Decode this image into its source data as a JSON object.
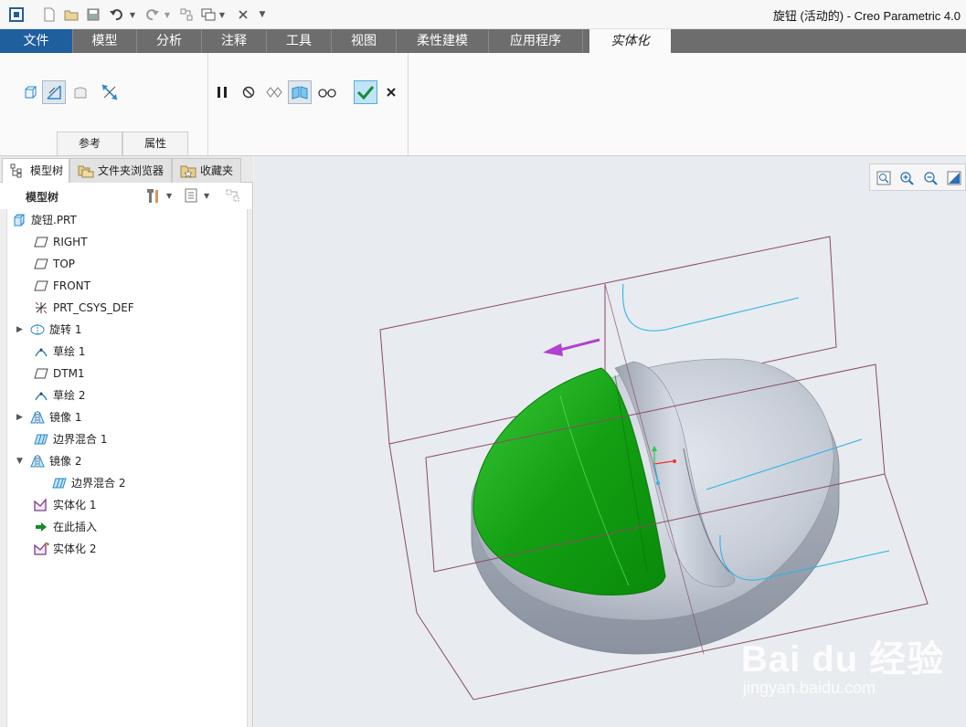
{
  "window": {
    "title": "旋钮 (活动的) - Creo Parametric 4.0"
  },
  "colors": {
    "accent": "#1f5f9e",
    "tabbar": "#6d6d6d",
    "solid_green": "#1aaa1a",
    "body_gray": "#aab2bf",
    "plane_line": "#8a4a66",
    "curve": "#2bb5e8"
  },
  "tabs": [
    {
      "label": "文件"
    },
    {
      "label": "模型"
    },
    {
      "label": "分析"
    },
    {
      "label": "注释"
    },
    {
      "label": "工具"
    },
    {
      "label": "视图"
    },
    {
      "label": "柔性建模"
    },
    {
      "label": "应用程序"
    },
    {
      "label": "实体化"
    }
  ],
  "ribbon": {
    "subtabs": [
      {
        "label": "参考"
      },
      {
        "label": "属性"
      }
    ]
  },
  "panel": {
    "tabs": [
      {
        "label": "模型树"
      },
      {
        "label": "文件夹浏览器"
      },
      {
        "label": "收藏夹"
      }
    ],
    "tree_title": "模型树",
    "tree": [
      {
        "label": "旋钮.PRT",
        "icon": "part-icon",
        "expander": ""
      },
      {
        "label": "RIGHT",
        "icon": "datum-plane-icon",
        "expander": ""
      },
      {
        "label": "TOP",
        "icon": "datum-plane-icon",
        "expander": ""
      },
      {
        "label": "FRONT",
        "icon": "datum-plane-icon",
        "expander": ""
      },
      {
        "label": "PRT_CSYS_DEF",
        "icon": "coordinate-system-icon",
        "expander": ""
      },
      {
        "label": "旋转 1",
        "icon": "revolve-icon",
        "expander": "▶"
      },
      {
        "label": "草绘 1",
        "icon": "sketch-icon",
        "expander": ""
      },
      {
        "label": "DTM1",
        "icon": "datum-plane-icon",
        "expander": ""
      },
      {
        "label": "草绘 2",
        "icon": "sketch-icon",
        "expander": ""
      },
      {
        "label": "镜像 1",
        "icon": "mirror-icon",
        "expander": "▶"
      },
      {
        "label": "边界混合 1",
        "icon": "boundary-blend-icon",
        "expander": ""
      },
      {
        "label": "镜像 2",
        "icon": "mirror-icon",
        "expander": "▼"
      },
      {
        "label": "边界混合 2",
        "icon": "boundary-blend-icon",
        "expander": ""
      },
      {
        "label": "实体化 1",
        "icon": "solidify-icon",
        "expander": ""
      },
      {
        "label": "在此插入",
        "icon": "insert-here-arrow-icon",
        "expander": ""
      },
      {
        "label": "实体化 2",
        "icon": "solidify-icon",
        "expander": ""
      }
    ]
  },
  "watermark": {
    "brand": "Bai du 经验",
    "url": "jingyan.baidu.com"
  }
}
